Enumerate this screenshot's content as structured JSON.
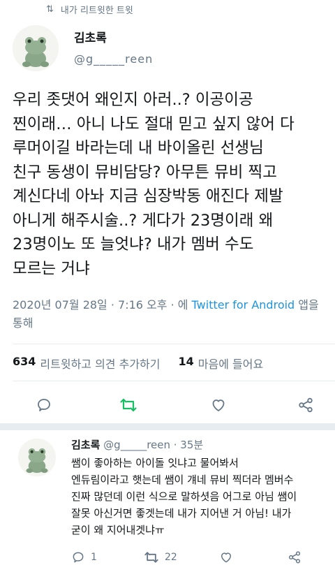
{
  "retweet_banner": {
    "icon": "retweet-icon",
    "text": "내가 리트윗한 트윗"
  },
  "author": {
    "display_name": "김초록",
    "handle": "@g_____reen",
    "avatar": "frog-plush-avatar"
  },
  "tweet": {
    "text": "우리 좃댓어 왜인지 아러..? 이공이공\n찐이래… 아니 나도 절대 믿고 싶지 않어 다\n루머이길 바라는데 내 바이올린 선생님\n친구 동생이 뮤비담당? 아무튼 뮤비 찍고\n계신다네 아놔 지금 심장박동 애진다 제발\n아니게 해주시술..? 게다가 23명이래 왜\n23명이노 또 늘엇냐? 내가 멤버 수도\n모르는 거냐"
  },
  "meta": {
    "date": "2020년 07월 28일 · 7:16 오후 · 에 ",
    "source": "Twitter for Android",
    "suffix": " 앱을\n통해"
  },
  "stats": {
    "retweets_count": "634",
    "retweets_label": "리트윗하고 의견 추가하기",
    "likes_count": "14",
    "likes_label": "마음에 들어요"
  },
  "actions": {
    "reply_icon": "comment-icon",
    "retweet_icon": "retweet-icon",
    "like_icon": "heart-icon",
    "share_icon": "share-icon",
    "retweet_active_color": "#17bf63"
  },
  "reply": {
    "display_name": "김초록",
    "handle_time": " @g_____reen · 35분",
    "text": "쌤이 좋아하는 아이돌 잇냐고 물어봐서\n엔듀림이라고 햇는데 쌤이 걔네 뮤비 찍더라 멤버수\n진짜 많던데 이런 식으로 말하셧음 어그로 아님 쌤이\n잘못 아신거면 좋겟는데 내가 지어낸 거 아님! 내가\n굳이 왜 지어내겟냐ㅠ",
    "reply_count": "1",
    "retweet_count": "22"
  }
}
